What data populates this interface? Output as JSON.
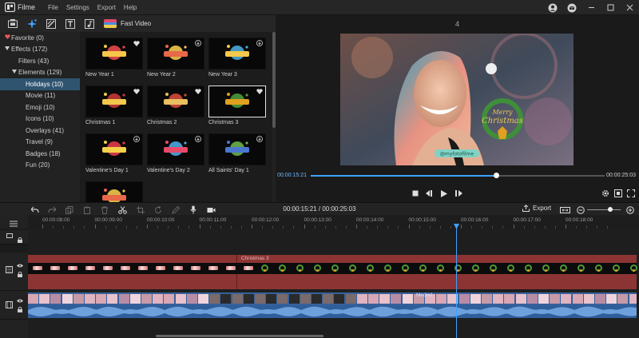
{
  "app": {
    "name": "Filme"
  },
  "menu": [
    "File",
    "Settings",
    "Export",
    "Help"
  ],
  "toolbar": {
    "tools": [
      "media-icon",
      "effects-icon",
      "transition-icon",
      "text-icon",
      "music-icon"
    ],
    "fast_video_label": "Fast Video"
  },
  "sidebar": {
    "items": [
      {
        "label": "Favorite (0)",
        "level": 0,
        "icon": "heart-icon",
        "selected": false
      },
      {
        "label": "Effects (172)",
        "level": 0,
        "icon": "triangle-down-icon",
        "selected": false
      },
      {
        "label": "Filters (43)",
        "level": 1,
        "icon": "",
        "selected": false
      },
      {
        "label": "Elements (129)",
        "level": 1,
        "icon": "triangle-down-icon",
        "selected": false
      },
      {
        "label": "Holidays (10)",
        "level": 2,
        "icon": "",
        "selected": true
      },
      {
        "label": "Movie (11)",
        "level": 2,
        "icon": "",
        "selected": false
      },
      {
        "label": "Emoji (10)",
        "level": 2,
        "icon": "",
        "selected": false
      },
      {
        "label": "Icons (10)",
        "level": 2,
        "icon": "",
        "selected": false
      },
      {
        "label": "Overlays (41)",
        "level": 2,
        "icon": "",
        "selected": false
      },
      {
        "label": "Travel (9)",
        "level": 2,
        "icon": "",
        "selected": false
      },
      {
        "label": "Badges (18)",
        "level": 2,
        "icon": "",
        "selected": false
      },
      {
        "label": "Fun (20)",
        "level": 2,
        "icon": "",
        "selected": false
      }
    ]
  },
  "library": {
    "items": [
      {
        "label": "New Year 1",
        "badge": "heart"
      },
      {
        "label": "New Year 2",
        "badge": "download"
      },
      {
        "label": "New Year 3",
        "badge": "download"
      },
      {
        "label": "Christmas 1",
        "badge": "heart"
      },
      {
        "label": "Christmas 2",
        "badge": "heart"
      },
      {
        "label": "Christmas 3",
        "badge": "heart"
      },
      {
        "label": "Valentine's Day 1",
        "badge": "download"
      },
      {
        "label": "Valentine's Day 2",
        "badge": "download"
      },
      {
        "label": "All Saints' Day 1",
        "badge": "download"
      },
      {
        "label": "",
        "badge": ""
      }
    ],
    "selected_index": 5
  },
  "preview": {
    "track_number": "4",
    "overlay_text_1": "Merry",
    "overlay_text_2": "Christmas",
    "handle": "@myfotofilme",
    "current_time": "00:00:15:21",
    "total_time": "00:00:25:03",
    "progress": 0.63
  },
  "timeline": {
    "time_display": "00:00:15:21 / 00:00:25:03",
    "export_label": "Export",
    "ruler_labels": [
      "00:00:08:00",
      "00:00:09:00",
      "00:00:10:00",
      "00:00:11:00",
      "00:00:12:00",
      "00:00:13:00",
      "00:00:14:00",
      "00:00:15:00",
      "00:00:16:00",
      "00:00:17:00",
      "00:00:18:00"
    ],
    "effect_clip_label": "Christmas 3",
    "media_clip_label": "Media1"
  },
  "colors": {
    "accent": "#3ea3ff",
    "selection": "#2e5470",
    "effect_clip": "#8c3434",
    "video_clip": "#37619a"
  }
}
